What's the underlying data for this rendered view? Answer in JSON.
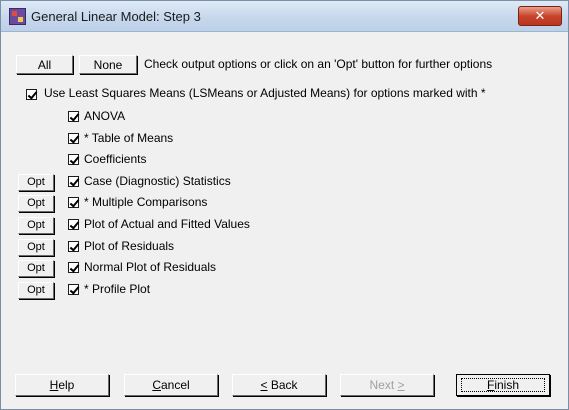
{
  "window": {
    "title": "General Linear Model: Step 3",
    "close_label": "✕"
  },
  "top_bar": {
    "all_label": "All",
    "none_label": "None",
    "instruction": "Check output options or click on an 'Opt' button for further options"
  },
  "lsmeans": {
    "checked": true,
    "label": "Use Least Squares Means (LSMeans or Adjusted Means) for options marked with *"
  },
  "options": [
    {
      "label": "ANOVA",
      "checked": true,
      "has_opt": false
    },
    {
      "label": "* Table of Means",
      "checked": true,
      "has_opt": false
    },
    {
      "label": "Coefficients",
      "checked": true,
      "has_opt": false
    },
    {
      "label": "Case (Diagnostic) Statistics",
      "checked": true,
      "has_opt": true
    },
    {
      "label": "* Multiple Comparisons",
      "checked": true,
      "has_opt": true
    },
    {
      "label": "Plot of Actual and Fitted Values",
      "checked": true,
      "has_opt": true
    },
    {
      "label": "Plot of Residuals",
      "checked": true,
      "has_opt": true
    },
    {
      "label": "Normal Plot of Residuals",
      "checked": true,
      "has_opt": true
    },
    {
      "label": "* Profile Plot",
      "checked": true,
      "has_opt": true
    }
  ],
  "opt_button_label": "Opt",
  "footer": {
    "help": {
      "pre": "",
      "u": "H",
      "post": "elp"
    },
    "cancel": {
      "pre": "",
      "u": "C",
      "post": "ancel"
    },
    "back": {
      "pre": "",
      "u": "<",
      "post": " Back"
    },
    "next": {
      "pre": "Next ",
      "u": ">",
      "post": ""
    },
    "finish": {
      "pre": "",
      "u": "F",
      "post": "inish"
    }
  }
}
